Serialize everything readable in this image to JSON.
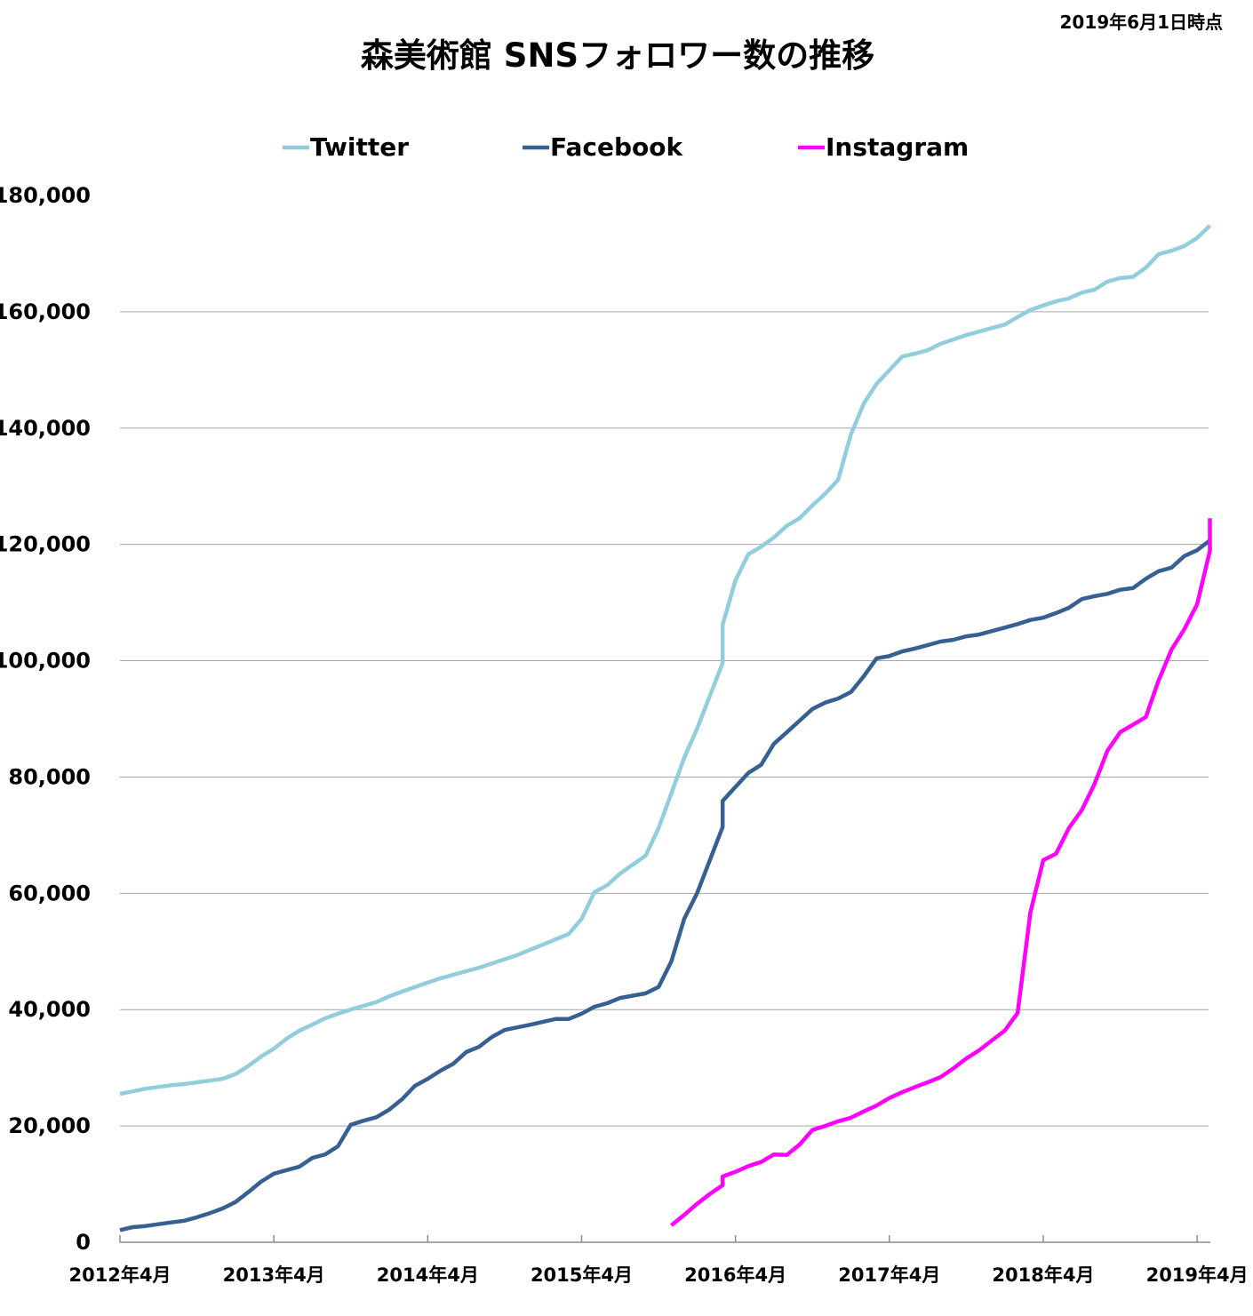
{
  "chart_data": {
    "type": "line",
    "title": "森美術館 SNSフォロワー数の推移",
    "note": "2019年6月1日時点",
    "xlabel": "",
    "ylabel": "",
    "ylim": [
      0,
      180000
    ],
    "y_ticks": [
      "0",
      "20,000",
      "40,000",
      "60,000",
      "80,000",
      "100,000",
      "120,000",
      "140,000",
      "160,000",
      "180,000"
    ],
    "x_ticks": [
      "2012年4月",
      "2013年4月",
      "2014年4月",
      "2015年4月",
      "2016年4月",
      "2017年4月",
      "2018年4月",
      "2019年4月"
    ],
    "x_tick_dates": [
      "2012-04",
      "2013-04",
      "2014-04",
      "2015-04",
      "2016-04",
      "2017-04",
      "2018-04",
      "2019-04"
    ],
    "grid": "horizontal",
    "legend": "top",
    "series": [
      {
        "name": "Twitter",
        "color": "#92CDDC",
        "points": [
          [
            "2012-04",
            25500
          ],
          [
            "2012-06",
            26400
          ],
          [
            "2012-08",
            27000
          ],
          [
            "2012-09",
            27200
          ],
          [
            "2012-12",
            28100
          ],
          [
            "2013-01",
            28900
          ],
          [
            "2013-02",
            30300
          ],
          [
            "2013-03",
            31900
          ],
          [
            "2013-04",
            33300
          ],
          [
            "2013-05",
            35000
          ],
          [
            "2013-06",
            36400
          ],
          [
            "2013-07",
            37400
          ],
          [
            "2013-08",
            38500
          ],
          [
            "2013-09",
            39300
          ],
          [
            "2013-10",
            40000
          ],
          [
            "2013-12",
            41300
          ],
          [
            "2014-01",
            42300
          ],
          [
            "2014-03",
            43900
          ],
          [
            "2014-05",
            45400
          ],
          [
            "2014-08",
            47200
          ],
          [
            "2014-11",
            49400
          ],
          [
            "2015-01",
            51200
          ],
          [
            "2015-03",
            53000
          ],
          [
            "2015-04",
            55600
          ],
          [
            "2015-05",
            60200
          ],
          [
            "2015-06",
            61400
          ],
          [
            "2015-07",
            63400
          ],
          [
            "2015-09",
            66500
          ],
          [
            "2015-10",
            71200
          ],
          [
            "2015-11",
            77200
          ],
          [
            "2015-12",
            83300
          ],
          [
            "2016-01",
            88300
          ],
          [
            "2016-03",
            99600
          ],
          [
            "2016-03",
            106200
          ],
          [
            "2016-04",
            113800
          ],
          [
            "2016-05",
            118300
          ],
          [
            "2016-06",
            119600
          ],
          [
            "2016-07",
            121200
          ],
          [
            "2016-08",
            123200
          ],
          [
            "2016-09",
            124500
          ],
          [
            "2016-10",
            126700
          ],
          [
            "2016-11",
            128700
          ],
          [
            "2016-12",
            131100
          ],
          [
            "2017-01",
            138900
          ],
          [
            "2017-02",
            144200
          ],
          [
            "2017-03",
            147600
          ],
          [
            "2017-05",
            152300
          ],
          [
            "2017-06",
            152800
          ],
          [
            "2017-07",
            153400
          ],
          [
            "2017-08",
            154500
          ],
          [
            "2017-10",
            156000
          ],
          [
            "2017-12",
            157200
          ],
          [
            "2018-01",
            157800
          ],
          [
            "2018-02",
            159100
          ],
          [
            "2018-03",
            160300
          ],
          [
            "2018-04",
            161100
          ],
          [
            "2018-05",
            161800
          ],
          [
            "2018-06",
            162300
          ],
          [
            "2018-07",
            163300
          ],
          [
            "2018-08",
            163800
          ],
          [
            "2018-09",
            165200
          ],
          [
            "2018-10",
            165800
          ],
          [
            "2018-11",
            166000
          ],
          [
            "2018-12",
            167600
          ],
          [
            "2019-01",
            169900
          ],
          [
            "2019-02",
            170500
          ],
          [
            "2019-03",
            171300
          ],
          [
            "2019-04",
            172700
          ],
          [
            "2019-05",
            174800
          ]
        ]
      },
      {
        "name": "Facebook",
        "color": "#366092",
        "points": [
          [
            "2012-04",
            2100
          ],
          [
            "2012-05",
            2600
          ],
          [
            "2012-06",
            2800
          ],
          [
            "2012-08",
            3400
          ],
          [
            "2012-09",
            3700
          ],
          [
            "2012-10",
            4300
          ],
          [
            "2012-11",
            5000
          ],
          [
            "2012-12",
            5800
          ],
          [
            "2013-01",
            6900
          ],
          [
            "2013-02",
            8600
          ],
          [
            "2013-03",
            10400
          ],
          [
            "2013-04",
            11800
          ],
          [
            "2013-05",
            12400
          ],
          [
            "2013-06",
            13000
          ],
          [
            "2013-07",
            14500
          ],
          [
            "2013-08",
            15100
          ],
          [
            "2013-09",
            16500
          ],
          [
            "2013-10",
            20200
          ],
          [
            "2013-11",
            20900
          ],
          [
            "2013-12",
            21500
          ],
          [
            "2014-01",
            22800
          ],
          [
            "2014-02",
            24600
          ],
          [
            "2014-03",
            26900
          ],
          [
            "2014-04",
            28100
          ],
          [
            "2014-05",
            29500
          ],
          [
            "2014-06",
            30700
          ],
          [
            "2014-07",
            32700
          ],
          [
            "2014-08",
            33600
          ],
          [
            "2014-09",
            35300
          ],
          [
            "2014-10",
            36500
          ],
          [
            "2014-12",
            37400
          ],
          [
            "2015-02",
            38400
          ],
          [
            "2015-03",
            38400
          ],
          [
            "2015-04",
            39300
          ],
          [
            "2015-05",
            40500
          ],
          [
            "2015-06",
            41100
          ],
          [
            "2015-07",
            42000
          ],
          [
            "2015-09",
            42800
          ],
          [
            "2015-10",
            43900
          ],
          [
            "2015-11",
            48300
          ],
          [
            "2015-12",
            55600
          ],
          [
            "2016-01",
            60000
          ],
          [
            "2016-03",
            71400
          ],
          [
            "2016-03",
            75900
          ],
          [
            "2016-05",
            80700
          ],
          [
            "2016-06",
            82100
          ],
          [
            "2016-07",
            85700
          ],
          [
            "2016-08",
            87700
          ],
          [
            "2016-09",
            89700
          ],
          [
            "2016-10",
            91700
          ],
          [
            "2016-11",
            92800
          ],
          [
            "2016-12",
            93500
          ],
          [
            "2017-01",
            94600
          ],
          [
            "2017-02",
            97300
          ],
          [
            "2017-03",
            100400
          ],
          [
            "2017-04",
            100800
          ],
          [
            "2017-05",
            101600
          ],
          [
            "2017-06",
            102100
          ],
          [
            "2017-07",
            102700
          ],
          [
            "2017-08",
            103300
          ],
          [
            "2017-09",
            103600
          ],
          [
            "2017-10",
            104200
          ],
          [
            "2017-11",
            104500
          ],
          [
            "2017-12",
            105100
          ],
          [
            "2018-01",
            105700
          ],
          [
            "2018-02",
            106300
          ],
          [
            "2018-03",
            107000
          ],
          [
            "2018-04",
            107400
          ],
          [
            "2018-05",
            108200
          ],
          [
            "2018-06",
            109100
          ],
          [
            "2018-07",
            110600
          ],
          [
            "2018-08",
            111100
          ],
          [
            "2018-09",
            111500
          ],
          [
            "2018-10",
            112200
          ],
          [
            "2018-11",
            112500
          ],
          [
            "2018-12",
            114100
          ],
          [
            "2019-01",
            115400
          ],
          [
            "2019-02",
            116000
          ],
          [
            "2019-03",
            118000
          ],
          [
            "2019-04",
            119000
          ],
          [
            "2019-05",
            120700
          ]
        ]
      },
      {
        "name": "Instagram",
        "color": "#FF00FF",
        "points": [
          [
            "2015-11",
            2900
          ],
          [
            "2015-12",
            4700
          ],
          [
            "2016-01",
            6600
          ],
          [
            "2016-02",
            8300
          ],
          [
            "2016-03",
            9800
          ],
          [
            "2016-03",
            11300
          ],
          [
            "2016-04",
            12100
          ],
          [
            "2016-05",
            13100
          ],
          [
            "2016-06",
            13800
          ],
          [
            "2016-07",
            15100
          ],
          [
            "2016-08",
            15000
          ],
          [
            "2016-09",
            16800
          ],
          [
            "2016-10",
            19300
          ],
          [
            "2016-11",
            20000
          ],
          [
            "2016-12",
            20800
          ],
          [
            "2017-01",
            21400
          ],
          [
            "2017-02",
            22500
          ],
          [
            "2017-03",
            23500
          ],
          [
            "2017-04",
            24800
          ],
          [
            "2017-05",
            25800
          ],
          [
            "2017-06",
            26700
          ],
          [
            "2017-07",
            27500
          ],
          [
            "2017-08",
            28400
          ],
          [
            "2017-09",
            29900
          ],
          [
            "2017-10",
            31600
          ],
          [
            "2017-11",
            33000
          ],
          [
            "2017-12",
            34700
          ],
          [
            "2018-01",
            36400
          ],
          [
            "2018-02",
            39400
          ],
          [
            "2018-03",
            56700
          ],
          [
            "2018-04",
            65700
          ],
          [
            "2018-05",
            66800
          ],
          [
            "2018-06",
            71200
          ],
          [
            "2018-07",
            74300
          ],
          [
            "2018-08",
            78800
          ],
          [
            "2018-09",
            84500
          ],
          [
            "2018-10",
            87700
          ],
          [
            "2018-12",
            90300
          ],
          [
            "2019-01",
            96600
          ],
          [
            "2019-02",
            101900
          ],
          [
            "2019-03",
            105400
          ],
          [
            "2019-04",
            109700
          ],
          [
            "2019-05",
            118900
          ],
          [
            "2019-05",
            124500
          ]
        ]
      }
    ]
  }
}
